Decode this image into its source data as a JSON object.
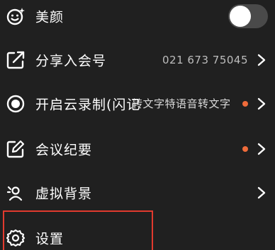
{
  "menu": {
    "beauty": {
      "label": "美颜",
      "icon": "smile-sparkle-icon",
      "toggle_on": false
    },
    "share": {
      "label": "分享入会号",
      "value": "021 673 75045",
      "icon": "share-out-icon"
    },
    "record": {
      "label": "开启云录制(闪记",
      "icon": "record-icon",
      "has_dot": true
    },
    "minutes": {
      "label": "会议纪要",
      "icon": "edit-note-icon",
      "has_dot": true
    },
    "background": {
      "label": "虚拟背景",
      "icon": "person-background-icon"
    },
    "settings": {
      "label": "设置",
      "icon": "gear-icon"
    }
  },
  "overlay": {
    "text": "转文字特语音转文字"
  },
  "colors": {
    "background": "#202020",
    "text": "#ffffff",
    "muted": "#bdbdbd",
    "dot": "#ef6b3a",
    "highlight": "#e23a2e",
    "toggle_track": "#4a4a4a"
  }
}
